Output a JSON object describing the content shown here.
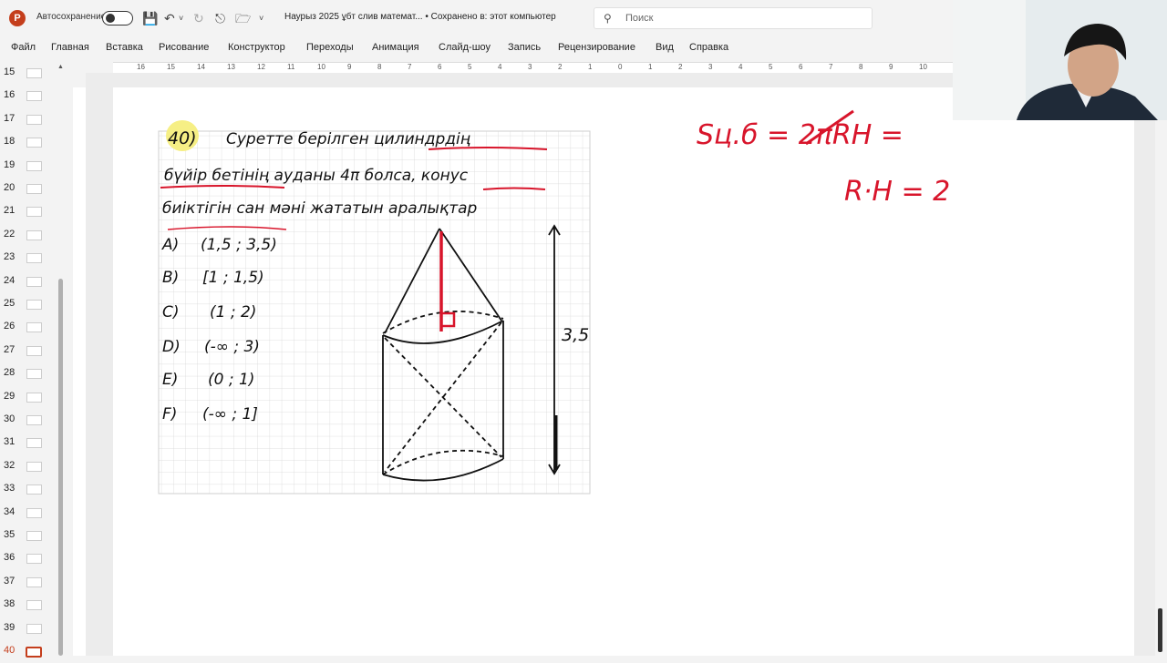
{
  "titlebar": {
    "app_icon": "P",
    "autosave_label": "Автосохранение",
    "document_title": "Наурыз 2025 ұбт слив математ... • Сохранено в: этот компьютер",
    "search_placeholder": "Поиск",
    "icons": [
      "save-icon",
      "undo-icon",
      "redo-icon",
      "present-icon",
      "open-icon",
      "customize-icon"
    ]
  },
  "menu": [
    "Файл",
    "Главная",
    "Вставка",
    "Рисование",
    "Конструктор",
    "Переходы",
    "Анимация",
    "Слайд-шоу",
    "Запись",
    "Рецензирование",
    "Вид",
    "Справка"
  ],
  "ruler": [
    "16",
    "15",
    "14",
    "13",
    "12",
    "11",
    "10",
    "9",
    "8",
    "7",
    "6",
    "5",
    "4",
    "3",
    "2",
    "1",
    "0",
    "1",
    "2",
    "3",
    "4",
    "5",
    "6",
    "7",
    "8",
    "9",
    "10"
  ],
  "thumbnails": [
    "15",
    "16",
    "17",
    "18",
    "19",
    "20",
    "21",
    "22",
    "23",
    "24",
    "25",
    "26",
    "27",
    "28",
    "29",
    "30",
    "31",
    "32",
    "33",
    "34",
    "35",
    "36",
    "37",
    "38",
    "39",
    "40"
  ],
  "active_slide": "40",
  "problem": {
    "number": "40)",
    "line1": "Суретте берілген цилиндрдің",
    "line2": "бүйір бетінің ауданы 4π болса, конус",
    "line3": "биіктігін сан мәні жататын аралықтар",
    "options": [
      {
        "letter": "A)",
        "text": "(1,5 ; 3,5)"
      },
      {
        "letter": "B)",
        "text": "[1 ; 1,5)"
      },
      {
        "letter": "C)",
        "text": "(1 ; 2)"
      },
      {
        "letter": "D)",
        "text": "(-∞ ; 3)"
      },
      {
        "letter": "E)",
        "text": "(0 ; 1)"
      },
      {
        "letter": "F)",
        "text": "(-∞ ; 1]"
      }
    ],
    "height_label": "3,5"
  },
  "annotations": {
    "formula1": "Sц.б = 2πRH =",
    "formula2": "R·H = 2"
  },
  "colors": {
    "accent": "#c43e1c",
    "ink": "#111111",
    "red_ink": "#d8152b",
    "highlight": "#f6ef85"
  }
}
